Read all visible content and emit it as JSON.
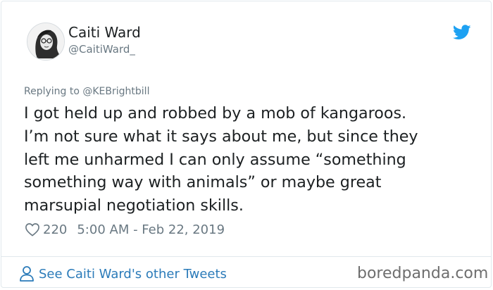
{
  "author": {
    "name": "Caiti Ward",
    "handle": "@CaitiWard_"
  },
  "reply_context": "Replying to @KEBrightbill",
  "tweet": {
    "lines": [
      "I got held up and robbed by a mob of kangaroos.",
      "I’m not sure what it says about me, but since they",
      "left me unharmed I can only assume “something",
      "something way with animals” or maybe great",
      "marsupial negotiation skills."
    ],
    "likes": "220",
    "timestamp": "5:00 AM - Feb 22, 2019"
  },
  "footer": {
    "link_label": "See Caiti Ward's other Tweets"
  },
  "watermark": "boredpanda.com",
  "colors": {
    "twitter_blue": "#1da1f2",
    "link": "#2b7bb9",
    "muted": "#697882",
    "text": "#1c2022"
  },
  "icons": [
    "avatar-image",
    "twitter-bird-icon",
    "heart-icon",
    "person-icon"
  ]
}
